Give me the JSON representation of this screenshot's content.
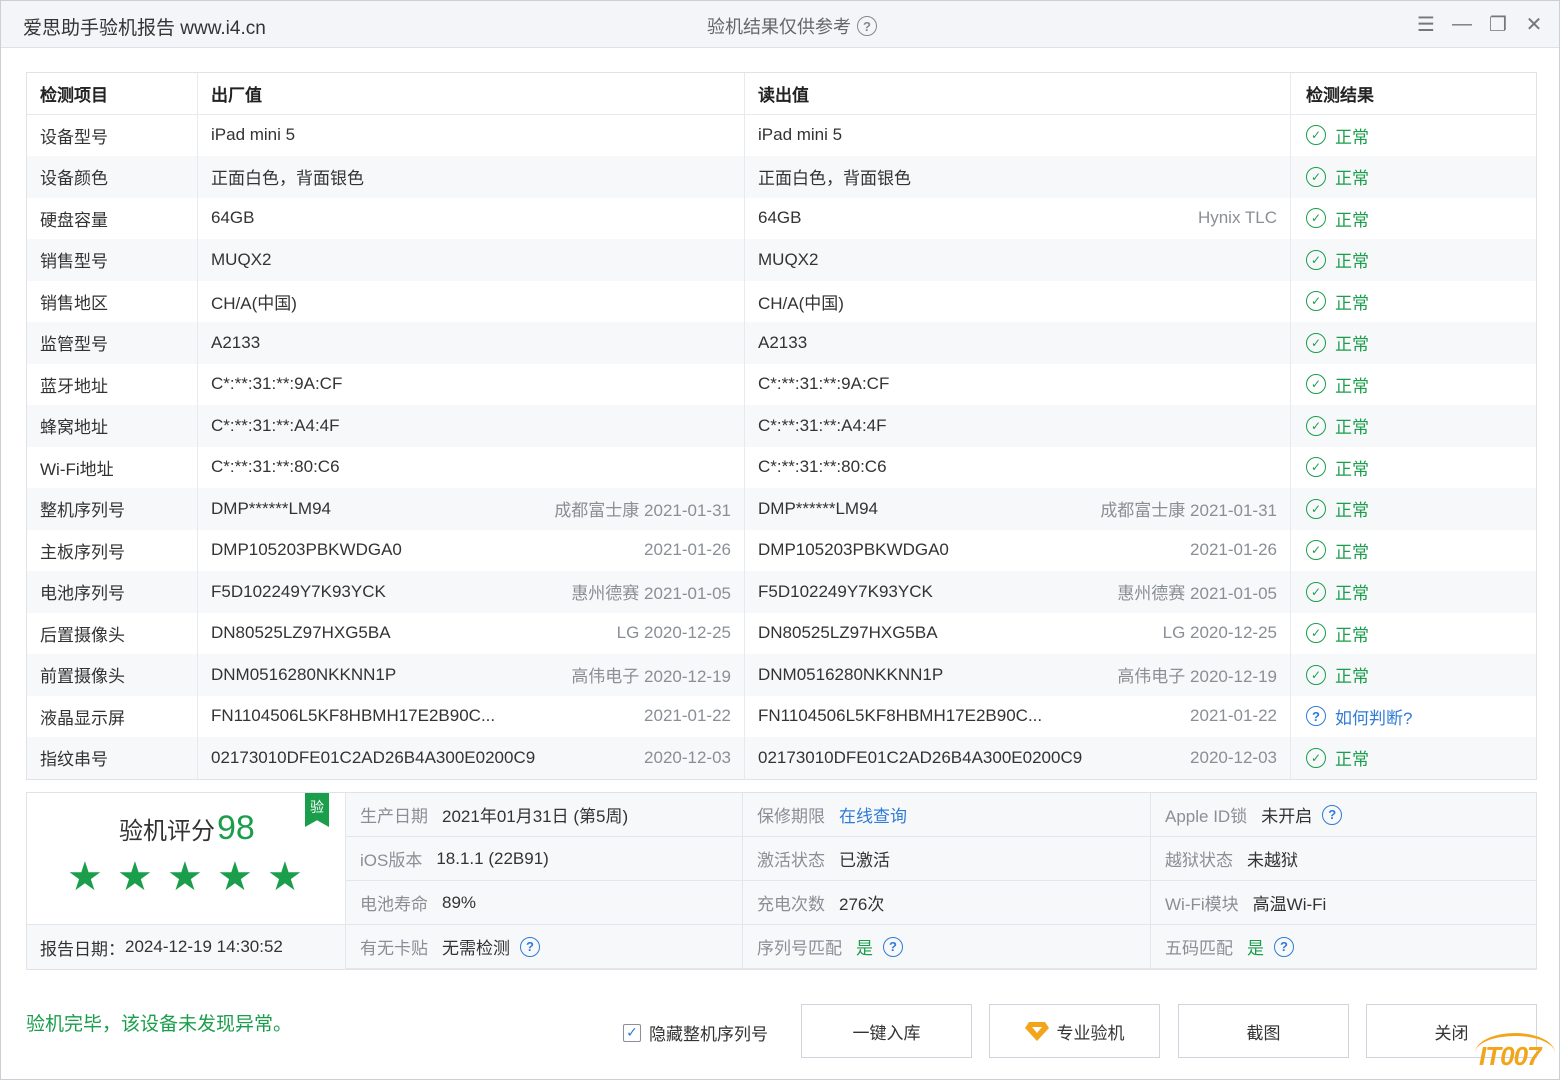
{
  "titlebar": {
    "app_title": "爱思助手验机报告 www.i4.cn",
    "center_title": "验机结果仅供参考",
    "help_glyph": "?",
    "controls": {
      "menu": "☰",
      "minimize": "—",
      "restore": "❐",
      "close": "✕"
    }
  },
  "table": {
    "headers": [
      "检测项目",
      "出厂值",
      "读出值",
      "检测结果"
    ],
    "rows": [
      {
        "item": "设备型号",
        "factory": "iPad mini 5",
        "factory_sub": "",
        "read": "iPad mini 5",
        "read_sub": "",
        "result": "正常",
        "status": "ok"
      },
      {
        "item": "设备颜色",
        "factory": "正面白色，背面银色",
        "factory_sub": "",
        "read": "正面白色，背面银色",
        "read_sub": "",
        "result": "正常",
        "status": "ok"
      },
      {
        "item": "硬盘容量",
        "factory": "64GB",
        "factory_sub": "",
        "read": "64GB",
        "read_sub": "Hynix TLC",
        "result": "正常",
        "status": "ok"
      },
      {
        "item": "销售型号",
        "factory": "MUQX2",
        "factory_sub": "",
        "read": "MUQX2",
        "read_sub": "",
        "result": "正常",
        "status": "ok"
      },
      {
        "item": "销售地区",
        "factory": "CH/A(中国)",
        "factory_sub": "",
        "read": "CH/A(中国)",
        "read_sub": "",
        "result": "正常",
        "status": "ok"
      },
      {
        "item": "监管型号",
        "factory": "A2133",
        "factory_sub": "",
        "read": "A2133",
        "read_sub": "",
        "result": "正常",
        "status": "ok"
      },
      {
        "item": "蓝牙地址",
        "factory": "C*:**:31:**:9A:CF",
        "factory_sub": "",
        "read": "C*:**:31:**:9A:CF",
        "read_sub": "",
        "result": "正常",
        "status": "ok"
      },
      {
        "item": "蜂窝地址",
        "factory": "C*:**:31:**:A4:4F",
        "factory_sub": "",
        "read": "C*:**:31:**:A4:4F",
        "read_sub": "",
        "result": "正常",
        "status": "ok"
      },
      {
        "item": "Wi-Fi地址",
        "factory": "C*:**:31:**:80:C6",
        "factory_sub": "",
        "read": "C*:**:31:**:80:C6",
        "read_sub": "",
        "result": "正常",
        "status": "ok"
      },
      {
        "item": "整机序列号",
        "factory": "DMP******LM94",
        "factory_sub": "成都富士康 2021-01-31",
        "read": "DMP******LM94",
        "read_sub": "成都富士康 2021-01-31",
        "result": "正常",
        "status": "ok"
      },
      {
        "item": "主板序列号",
        "factory": "DMP105203PBKWDGA0",
        "factory_sub": "2021-01-26",
        "read": "DMP105203PBKWDGA0",
        "read_sub": "2021-01-26",
        "result": "正常",
        "status": "ok"
      },
      {
        "item": "电池序列号",
        "factory": "F5D102249Y7K93YCK",
        "factory_sub": "惠州德赛 2021-01-05",
        "read": "F5D102249Y7K93YCK",
        "read_sub": "惠州德赛 2021-01-05",
        "result": "正常",
        "status": "ok"
      },
      {
        "item": "后置摄像头",
        "factory": "DN80525LZ97HXG5BA",
        "factory_sub": "LG 2020-12-25",
        "read": "DN80525LZ97HXG5BA",
        "read_sub": "LG 2020-12-25",
        "result": "正常",
        "status": "ok"
      },
      {
        "item": "前置摄像头",
        "factory": "DNM0516280NKKNN1P",
        "factory_sub": "高伟电子 2020-12-19",
        "read": "DNM0516280NKKNN1P",
        "read_sub": "高伟电子 2020-12-19",
        "result": "正常",
        "status": "ok"
      },
      {
        "item": "液晶显示屏",
        "factory": "FN1104506L5KF8HBMH17E2B90C...",
        "factory_sub": "2021-01-22",
        "read": "FN1104506L5KF8HBMH17E2B90C...",
        "read_sub": "2021-01-22",
        "result": "如何判断?",
        "status": "ask"
      },
      {
        "item": "指纹串号",
        "factory": "02173010DFE01C2AD26B4A300E0200C9",
        "factory_sub": "2020-12-03",
        "read": "02173010DFE01C2AD26B4A300E0200C9",
        "read_sub": "2020-12-03",
        "result": "正常",
        "status": "ok"
      }
    ]
  },
  "score": {
    "label": "验机评分",
    "value": "98",
    "badge": "验",
    "stars": 5,
    "report_date_label": "报告日期：",
    "report_date": "2024-12-19 14:30:52"
  },
  "info": [
    [
      {
        "label": "生产日期",
        "value": "2021年01月31日 (第5周)",
        "style": "val",
        "help": false
      },
      {
        "label": "保修期限",
        "value": "在线查询",
        "style": "link",
        "help": false
      },
      {
        "label": "Apple ID锁",
        "value": "未开启",
        "style": "val",
        "help": true
      }
    ],
    [
      {
        "label": "iOS版本",
        "value": "18.1.1 (22B91)",
        "style": "val",
        "help": false
      },
      {
        "label": "激活状态",
        "value": "已激活",
        "style": "val",
        "help": false
      },
      {
        "label": "越狱状态",
        "value": "未越狱",
        "style": "val",
        "help": false
      }
    ],
    [
      {
        "label": "电池寿命",
        "value": "89%",
        "style": "val",
        "help": false
      },
      {
        "label": "充电次数",
        "value": "276次",
        "style": "val",
        "help": false
      },
      {
        "label": "Wi-Fi模块",
        "value": "高温Wi-Fi",
        "style": "val",
        "help": false
      }
    ],
    [
      {
        "label": "有无卡贴",
        "value": "无需检测",
        "style": "val",
        "help": true
      },
      {
        "label": "序列号匹配",
        "value": "是",
        "style": "green",
        "help": true
      },
      {
        "label": "五码匹配",
        "value": "是",
        "style": "green",
        "help": true
      }
    ]
  ],
  "footer": {
    "status_message": "验机完毕，该设备未发现异常。",
    "hide_serial_label": "隐藏整机序列号",
    "hide_serial_checked": true,
    "buttons": {
      "import": "一键入库",
      "pro": "专业验机",
      "screenshot": "截图",
      "close": "关闭"
    }
  },
  "watermark": "IT007",
  "colors": {
    "green": "#1a9e4b",
    "blue": "#2f7bd8",
    "gray_text": "#8a8f96",
    "watermark": "#f2a51a"
  }
}
